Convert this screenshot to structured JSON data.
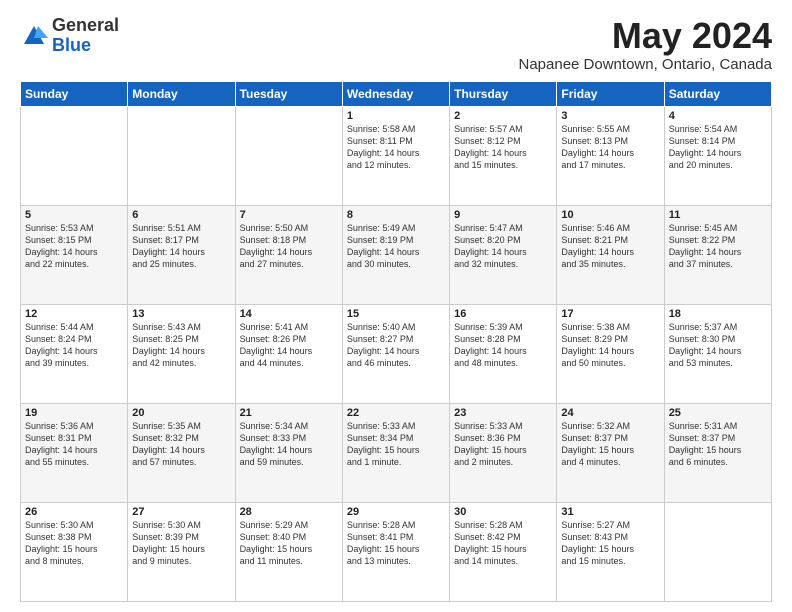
{
  "logo": {
    "general": "General",
    "blue": "Blue"
  },
  "title": "May 2024",
  "location": "Napanee Downtown, Ontario, Canada",
  "days_of_week": [
    "Sunday",
    "Monday",
    "Tuesday",
    "Wednesday",
    "Thursday",
    "Friday",
    "Saturday"
  ],
  "weeks": [
    [
      {
        "day": "",
        "info": ""
      },
      {
        "day": "",
        "info": ""
      },
      {
        "day": "",
        "info": ""
      },
      {
        "day": "1",
        "info": "Sunrise: 5:58 AM\nSunset: 8:11 PM\nDaylight: 14 hours\nand 12 minutes."
      },
      {
        "day": "2",
        "info": "Sunrise: 5:57 AM\nSunset: 8:12 PM\nDaylight: 14 hours\nand 15 minutes."
      },
      {
        "day": "3",
        "info": "Sunrise: 5:55 AM\nSunset: 8:13 PM\nDaylight: 14 hours\nand 17 minutes."
      },
      {
        "day": "4",
        "info": "Sunrise: 5:54 AM\nSunset: 8:14 PM\nDaylight: 14 hours\nand 20 minutes."
      }
    ],
    [
      {
        "day": "5",
        "info": "Sunrise: 5:53 AM\nSunset: 8:15 PM\nDaylight: 14 hours\nand 22 minutes."
      },
      {
        "day": "6",
        "info": "Sunrise: 5:51 AM\nSunset: 8:17 PM\nDaylight: 14 hours\nand 25 minutes."
      },
      {
        "day": "7",
        "info": "Sunrise: 5:50 AM\nSunset: 8:18 PM\nDaylight: 14 hours\nand 27 minutes."
      },
      {
        "day": "8",
        "info": "Sunrise: 5:49 AM\nSunset: 8:19 PM\nDaylight: 14 hours\nand 30 minutes."
      },
      {
        "day": "9",
        "info": "Sunrise: 5:47 AM\nSunset: 8:20 PM\nDaylight: 14 hours\nand 32 minutes."
      },
      {
        "day": "10",
        "info": "Sunrise: 5:46 AM\nSunset: 8:21 PM\nDaylight: 14 hours\nand 35 minutes."
      },
      {
        "day": "11",
        "info": "Sunrise: 5:45 AM\nSunset: 8:22 PM\nDaylight: 14 hours\nand 37 minutes."
      }
    ],
    [
      {
        "day": "12",
        "info": "Sunrise: 5:44 AM\nSunset: 8:24 PM\nDaylight: 14 hours\nand 39 minutes."
      },
      {
        "day": "13",
        "info": "Sunrise: 5:43 AM\nSunset: 8:25 PM\nDaylight: 14 hours\nand 42 minutes."
      },
      {
        "day": "14",
        "info": "Sunrise: 5:41 AM\nSunset: 8:26 PM\nDaylight: 14 hours\nand 44 minutes."
      },
      {
        "day": "15",
        "info": "Sunrise: 5:40 AM\nSunset: 8:27 PM\nDaylight: 14 hours\nand 46 minutes."
      },
      {
        "day": "16",
        "info": "Sunrise: 5:39 AM\nSunset: 8:28 PM\nDaylight: 14 hours\nand 48 minutes."
      },
      {
        "day": "17",
        "info": "Sunrise: 5:38 AM\nSunset: 8:29 PM\nDaylight: 14 hours\nand 50 minutes."
      },
      {
        "day": "18",
        "info": "Sunrise: 5:37 AM\nSunset: 8:30 PM\nDaylight: 14 hours\nand 53 minutes."
      }
    ],
    [
      {
        "day": "19",
        "info": "Sunrise: 5:36 AM\nSunset: 8:31 PM\nDaylight: 14 hours\nand 55 minutes."
      },
      {
        "day": "20",
        "info": "Sunrise: 5:35 AM\nSunset: 8:32 PM\nDaylight: 14 hours\nand 57 minutes."
      },
      {
        "day": "21",
        "info": "Sunrise: 5:34 AM\nSunset: 8:33 PM\nDaylight: 14 hours\nand 59 minutes."
      },
      {
        "day": "22",
        "info": "Sunrise: 5:33 AM\nSunset: 8:34 PM\nDaylight: 15 hours\nand 1 minute."
      },
      {
        "day": "23",
        "info": "Sunrise: 5:33 AM\nSunset: 8:36 PM\nDaylight: 15 hours\nand 2 minutes."
      },
      {
        "day": "24",
        "info": "Sunrise: 5:32 AM\nSunset: 8:37 PM\nDaylight: 15 hours\nand 4 minutes."
      },
      {
        "day": "25",
        "info": "Sunrise: 5:31 AM\nSunset: 8:37 PM\nDaylight: 15 hours\nand 6 minutes."
      }
    ],
    [
      {
        "day": "26",
        "info": "Sunrise: 5:30 AM\nSunset: 8:38 PM\nDaylight: 15 hours\nand 8 minutes."
      },
      {
        "day": "27",
        "info": "Sunrise: 5:30 AM\nSunset: 8:39 PM\nDaylight: 15 hours\nand 9 minutes."
      },
      {
        "day": "28",
        "info": "Sunrise: 5:29 AM\nSunset: 8:40 PM\nDaylight: 15 hours\nand 11 minutes."
      },
      {
        "day": "29",
        "info": "Sunrise: 5:28 AM\nSunset: 8:41 PM\nDaylight: 15 hours\nand 13 minutes."
      },
      {
        "day": "30",
        "info": "Sunrise: 5:28 AM\nSunset: 8:42 PM\nDaylight: 15 hours\nand 14 minutes."
      },
      {
        "day": "31",
        "info": "Sunrise: 5:27 AM\nSunset: 8:43 PM\nDaylight: 15 hours\nand 15 minutes."
      },
      {
        "day": "",
        "info": ""
      }
    ]
  ]
}
